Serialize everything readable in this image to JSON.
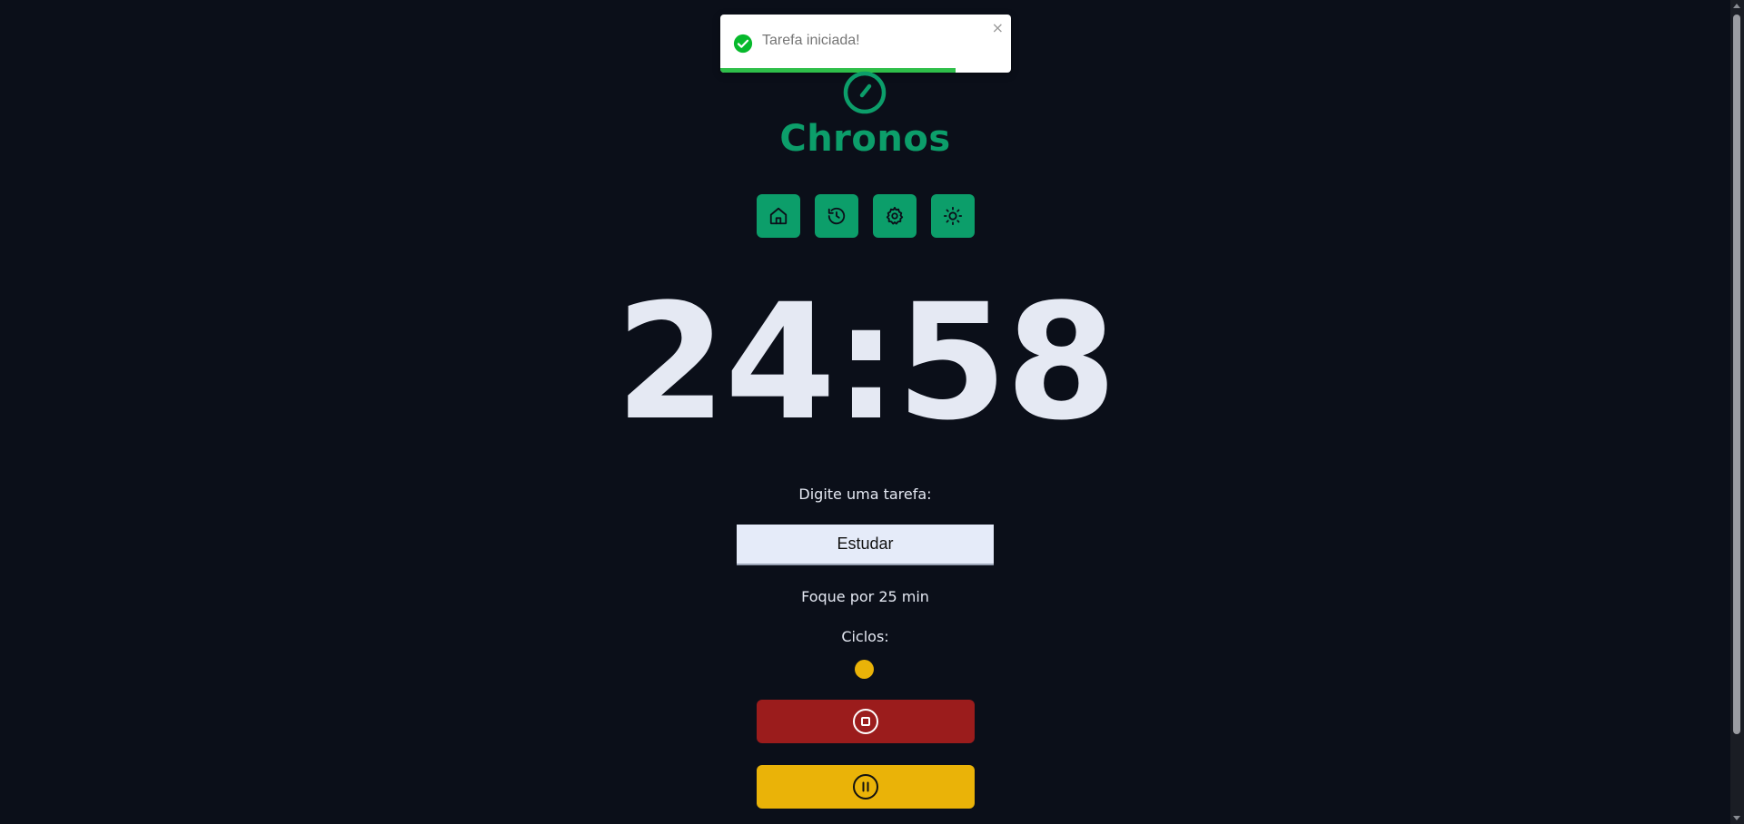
{
  "toast": {
    "message": "Tarefa iniciada!",
    "close_symbol": "×",
    "progress_percent": 81,
    "icon": "check-circle-icon",
    "accent_color": "#2fbf4a"
  },
  "app": {
    "title": "Chronos",
    "logo_icon": "timer-icon",
    "brand_color": "#0c9e6a"
  },
  "nav": {
    "items": [
      {
        "icon": "home-icon",
        "label": "Home"
      },
      {
        "icon": "history-icon",
        "label": "History"
      },
      {
        "icon": "settings-icon",
        "label": "Settings"
      },
      {
        "icon": "theme-sun-icon",
        "label": "Theme"
      }
    ]
  },
  "timer": {
    "display": "24:58"
  },
  "form": {
    "task_label": "Digite uma tarefa:",
    "task_value": "Estudar",
    "focus_text": "Foque por 25 min",
    "cycles_label": "Ciclos:",
    "cycles_completed": 1,
    "cycle_color": "#eab308"
  },
  "actions": {
    "stop_icon": "stop-circle-icon",
    "stop_color": "#9b1c1c",
    "pause_icon": "pause-circle-icon",
    "pause_color": "#eab308"
  }
}
